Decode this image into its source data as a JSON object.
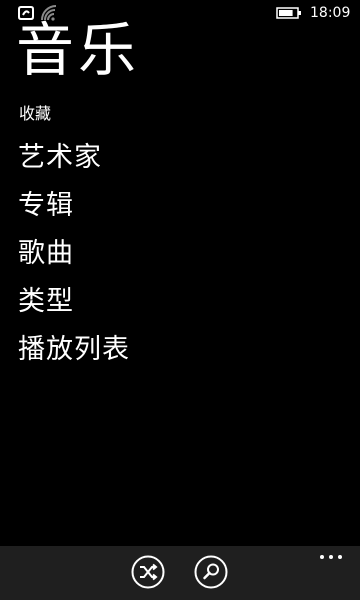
{
  "status_bar": {
    "time": "18:09",
    "battery_level": 0.8,
    "icons": [
      "app-notification-icon",
      "wifi-signal-icon",
      "battery-icon"
    ]
  },
  "page": {
    "title": "音乐",
    "subtitle": "收藏"
  },
  "menu": {
    "items": [
      {
        "label": "艺术家"
      },
      {
        "label": "专辑"
      },
      {
        "label": "歌曲"
      },
      {
        "label": "类型"
      },
      {
        "label": "播放列表"
      }
    ]
  },
  "app_bar": {
    "buttons": [
      "shuffle-icon",
      "search-icon"
    ],
    "more_icon": "more-dots-icon",
    "background": "#1f1f1f"
  },
  "colors": {
    "background": "#000000",
    "foreground": "#ffffff"
  }
}
